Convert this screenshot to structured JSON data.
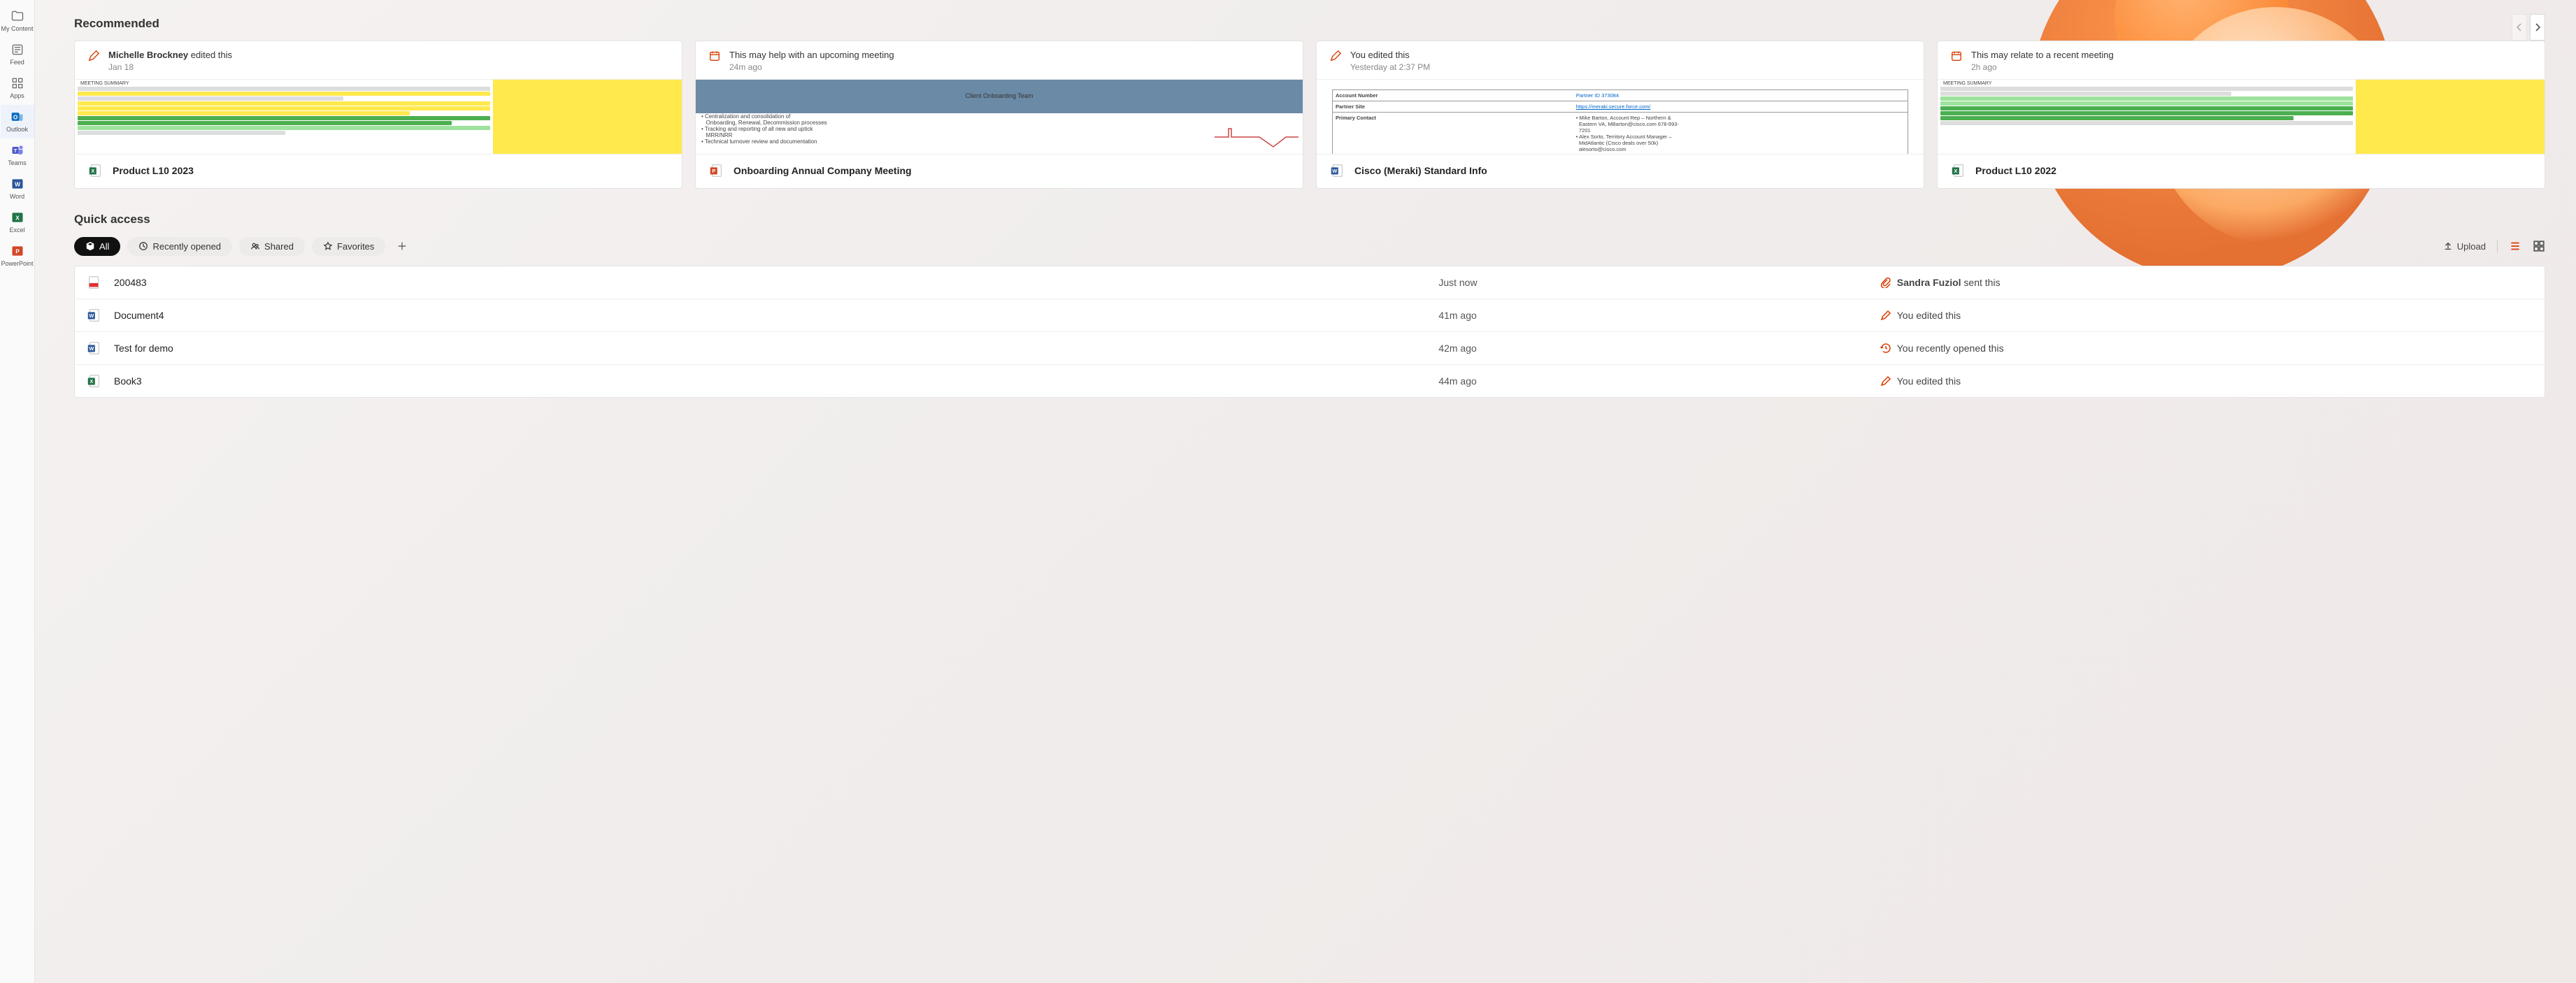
{
  "sidebar": [
    {
      "id": "my-content",
      "label": "My Content",
      "icon": "folder"
    },
    {
      "id": "feed",
      "label": "Feed",
      "icon": "feed"
    },
    {
      "id": "apps",
      "label": "Apps",
      "icon": "apps"
    },
    {
      "id": "outlook",
      "label": "Outlook",
      "icon": "outlook",
      "active": true
    },
    {
      "id": "teams",
      "label": "Teams",
      "icon": "teams"
    },
    {
      "id": "word",
      "label": "Word",
      "icon": "word"
    },
    {
      "id": "excel",
      "label": "Excel",
      "icon": "excel"
    },
    {
      "id": "powerpoint",
      "label": "PowerPoint",
      "icon": "powerpoint"
    }
  ],
  "recommended": {
    "title": "Recommended",
    "cards": [
      {
        "reason_prefix": "Michelle Brockney",
        "reason_suffix": " edited this",
        "when": "Jan 18",
        "kind": "excel",
        "name": "Product L10 2023"
      },
      {
        "reason_prefix": "",
        "reason_suffix": "This may help with an upcoming meeting",
        "when": "24m ago",
        "kind": "powerpoint",
        "name": "Onboarding Annual Company Meeting"
      },
      {
        "reason_prefix": "",
        "reason_suffix": "You edited this",
        "when": "Yesterday at 2:37 PM",
        "kind": "word",
        "name": "Cisco (Meraki) Standard Info"
      },
      {
        "reason_prefix": "",
        "reason_suffix": "This may relate to a recent meeting",
        "when": "2h ago",
        "kind": "excel",
        "name": "Product L10 2022"
      }
    ]
  },
  "quick_access": {
    "title": "Quick access",
    "filters": {
      "all": "All",
      "recent": "Recently opened",
      "shared": "Shared",
      "fav": "Favorites"
    },
    "upload": "Upload",
    "files": [
      {
        "icon": "pdf",
        "name": "200483",
        "when": "Just now",
        "activity_icon": "attach",
        "activity_bold": "Sandra Fuziol",
        "activity_plain": " sent this"
      },
      {
        "icon": "word",
        "name": "Document4",
        "when": "41m ago",
        "activity_icon": "pencil",
        "activity_bold": "",
        "activity_plain": "You edited this"
      },
      {
        "icon": "word",
        "name": "Test for demo",
        "when": "42m ago",
        "activity_icon": "recent",
        "activity_bold": "",
        "activity_plain": "You recently opened this"
      },
      {
        "icon": "excel",
        "name": "Book3",
        "when": "44m ago",
        "activity_icon": "pencil",
        "activity_bold": "",
        "activity_plain": "You edited this"
      }
    ]
  }
}
